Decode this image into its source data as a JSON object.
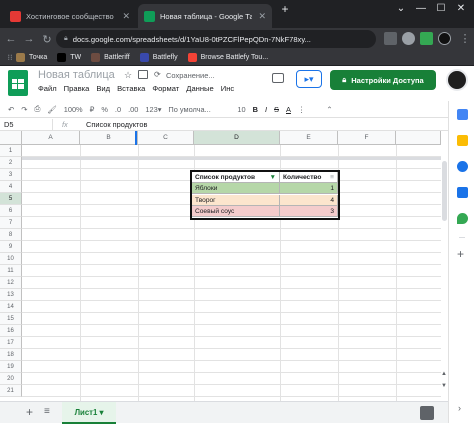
{
  "browser": {
    "tabs": [
      {
        "title": "Хостинговое сообщество «Tim",
        "favicon_color": "#e53935",
        "active": false
      },
      {
        "title": "Новая таблица - Google Табли",
        "favicon_color": "#0f9d58",
        "active": true
      }
    ],
    "new_tab": "+",
    "window_controls": [
      "⌄",
      "—",
      "☐",
      "✕"
    ],
    "url": "docs.google.com/spreadsheets/d/1YaU8-0tPZCFlPepQDn-7NkF78xy...",
    "bookmarks": [
      {
        "label": "Точка",
        "color": "#9b7a4a"
      },
      {
        "label": "TW",
        "color": "#000000"
      },
      {
        "label": "Battleriff",
        "color": "#6d4c41"
      },
      {
        "label": "Battlefly",
        "color": "#3949ab"
      },
      {
        "label": "Browse Battlefy Tou...",
        "color": "#f44336"
      }
    ]
  },
  "sheets": {
    "title": "Новая таблица",
    "save_status": "Сохранение...",
    "menu": [
      "Файл",
      "Правка",
      "Вид",
      "Вставка",
      "Формат",
      "Данные",
      "Инс"
    ],
    "share_label": "Настройки Доступа",
    "toolbar": {
      "zoom": "100%",
      "currency": "₽",
      "percent": "%",
      "dec_minus": ".0",
      "dec_plus": ".00",
      "format": "123▾",
      "font": "По умолча...",
      "font_size": "10",
      "bold": "B",
      "italic": "I",
      "strike": "S",
      "text_color": "A"
    },
    "name_box": "D5",
    "fx": "fx",
    "formula": "Список продуктов",
    "columns": [
      "A",
      "B",
      "C",
      "D",
      "E",
      "F"
    ],
    "selected_column": "D",
    "rows": [
      "1",
      "2",
      "3",
      "4",
      "5",
      "6",
      "7",
      "8",
      "9",
      "10",
      "11",
      "12",
      "13",
      "14",
      "15",
      "16",
      "17",
      "18",
      "19",
      "20",
      "21"
    ],
    "table": {
      "headers": [
        "Список продуктов",
        "Количество"
      ],
      "rows": [
        {
          "name": "Яблоки",
          "qty": "1",
          "color": "#b6d7a8"
        },
        {
          "name": "Творог",
          "qty": "4",
          "color": "#fce5cd"
        },
        {
          "name": "Соевый соус",
          "qty": "3",
          "color": "#f4cccc"
        }
      ]
    },
    "sheet_tab": "Лист1 ▾",
    "add_sheet": "+",
    "all_sheets": "≡"
  },
  "side_panel_icons": [
    {
      "name": "calendar-icon",
      "color": "#4285f4"
    },
    {
      "name": "keep-icon",
      "color": "#fbbc04"
    },
    {
      "name": "tasks-icon",
      "color": "#1a73e8"
    },
    {
      "name": "contacts-icon",
      "color": "#1a73e8"
    },
    {
      "name": "maps-icon",
      "color": "#34a853"
    }
  ]
}
